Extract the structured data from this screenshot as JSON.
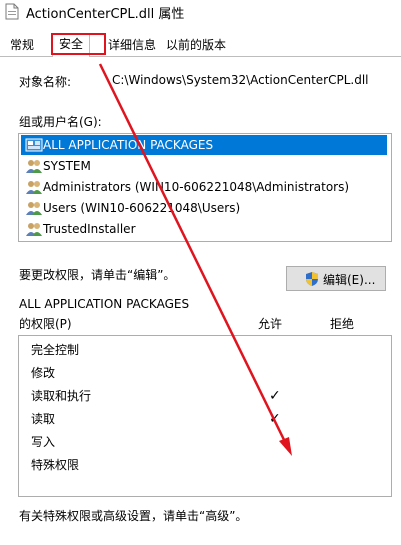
{
  "window": {
    "title": "ActionCenterCPL.dll 属性"
  },
  "tabs": [
    {
      "label": "常规",
      "active": false
    },
    {
      "label": "安全",
      "active": true
    },
    {
      "label": "详细信息",
      "active": false
    },
    {
      "label": "以前的版本",
      "active": false
    }
  ],
  "object": {
    "label": "对象名称:",
    "value": "C:\\Windows\\System32\\ActionCenterCPL.dll"
  },
  "groups": {
    "label": "组或用户名(G):",
    "items": [
      {
        "label": "ALL APPLICATION PACKAGES",
        "selected": true,
        "icon": "packages-icon"
      },
      {
        "label": "SYSTEM",
        "selected": false,
        "icon": "users-icon"
      },
      {
        "label": "Administrators (WIN10-606221048\\Administrators)",
        "selected": false,
        "icon": "users-icon"
      },
      {
        "label": "Users (WIN10-606221048\\Users)",
        "selected": false,
        "icon": "users-icon"
      },
      {
        "label": "TrustedInstaller",
        "selected": false,
        "icon": "users-icon"
      }
    ]
  },
  "change_hint": "要更改权限，请单击“编辑”。",
  "edit_button": {
    "label": "编辑(E)...",
    "icon": "uac-shield-icon"
  },
  "permissions": {
    "subject": "ALL APPLICATION PACKAGES",
    "for_label": "的权限(P)",
    "allow_header": "允许",
    "deny_header": "拒绝",
    "rows": [
      {
        "label": "完全控制",
        "allow": "",
        "deny": ""
      },
      {
        "label": "修改",
        "allow": "",
        "deny": ""
      },
      {
        "label": "读取和执行",
        "allow": "✓",
        "deny": ""
      },
      {
        "label": "读取",
        "allow": "✓",
        "deny": ""
      },
      {
        "label": "写入",
        "allow": "",
        "deny": ""
      },
      {
        "label": "特殊权限",
        "allow": "",
        "deny": ""
      }
    ]
  },
  "advanced_hint": "有关特殊权限或高级设置，请单击“高级”。",
  "colors": {
    "selection": "#0078d7",
    "annotation": "#e0141e"
  }
}
